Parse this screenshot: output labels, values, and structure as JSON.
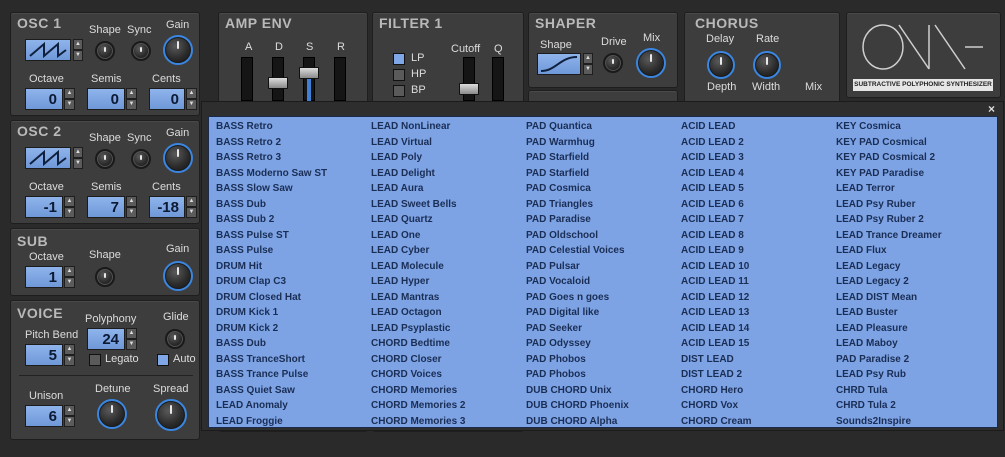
{
  "osc1": {
    "title": "OSC 1",
    "shape_label": "Shape",
    "sync_label": "Sync",
    "gain_label": "Gain",
    "octave_label": "Octave",
    "semis_label": "Semis",
    "cents_label": "Cents",
    "octave": "0",
    "semis": "0",
    "cents": "0"
  },
  "osc2": {
    "title": "OSC 2",
    "shape_label": "Shape",
    "sync_label": "Sync",
    "gain_label": "Gain",
    "octave_label": "Octave",
    "semis_label": "Semis",
    "cents_label": "Cents",
    "octave": "-1",
    "semis": "7",
    "cents": "-18"
  },
  "sub": {
    "title": "SUB",
    "octave_label": "Octave",
    "shape_label": "Shape",
    "gain_label": "Gain",
    "octave": "1"
  },
  "voice": {
    "title": "VOICE",
    "polyphony_label": "Polyphony",
    "glide_label": "Glide",
    "pitch_bend_label": "Pitch Bend",
    "polyphony": "24",
    "pitch_bend": "5",
    "legato_label": "Legato",
    "auto_label": "Auto",
    "legato_checked": false,
    "auto_checked": true
  },
  "unison": {
    "unison_label": "Unison",
    "detune_label": "Detune",
    "spread_label": "Spread",
    "unison": "6"
  },
  "amp_env": {
    "title": "AMP ENV",
    "a": "A",
    "d": "D",
    "s": "S",
    "r": "R"
  },
  "filter1": {
    "title": "FILTER 1",
    "cutoff_label": "Cutoff",
    "q_label": "Q",
    "modes": [
      "LP",
      "HP",
      "BP"
    ],
    "selected_mode": "LP"
  },
  "shaper": {
    "title": "SHAPER",
    "shape_label": "Shape",
    "drive_label": "Drive",
    "mix_label": "Mix"
  },
  "chorus": {
    "title": "CHORUS",
    "delay_label": "Delay",
    "rate_label": "Rate",
    "depth_label": "Depth",
    "width_label": "Width",
    "mix_label": "Mix"
  },
  "logo": {
    "subtitle": "SUBTRACTIVE POLYPHONIC SYNTHESIZER"
  },
  "preset_browser": {
    "close_symbol": "×",
    "columns": [
      [
        "BASS Retro",
        "BASS Retro 2",
        "BASS Retro 3",
        "BASS Moderno Saw ST",
        "BASS Slow Saw",
        "BASS Dub",
        "BASS Dub 2",
        "BASS Pulse ST",
        "BASS Pulse",
        "DRUM Hit",
        "DRUM Clap C3",
        "DRUM Closed Hat",
        "DRUM Kick 1",
        "DRUM Kick 2",
        "BASS Dub",
        "BASS TranceShort",
        "BASS Trance Pulse",
        "BASS Quiet Saw",
        "LEAD Anomaly",
        "LEAD Froggie"
      ],
      [
        "LEAD NonLinear",
        "LEAD Virtual",
        "LEAD Poly",
        "LEAD Delight",
        "LEAD Aura",
        "LEAD Sweet Bells",
        "LEAD Quartz",
        "LEAD One",
        "LEAD Cyber",
        "LEAD Molecule",
        "LEAD Hyper",
        "LEAD Mantras",
        "LEAD Octagon",
        "LEAD Psyplastic",
        "CHORD Bedtime",
        "CHORD Closer",
        "CHORD Voices",
        "CHORD Memories",
        "CHORD Memories 2",
        "CHORD Memories 3"
      ],
      [
        "PAD Quantica",
        "PAD Warmhug",
        "PAD Starfield",
        "PAD Starfield",
        "PAD Cosmica",
        "PAD Triangles",
        "PAD Paradise",
        "PAD Oldschool",
        "PAD Celestial Voices",
        "PAD Pulsar",
        "PAD Vocaloid",
        "PAD Goes n goes",
        "PAD Digital like",
        "PAD Seeker",
        "PAD Odyssey",
        "PAD Phobos",
        "PAD Phobos",
        "DUB CHORD Unix",
        "DUB CHORD Phoenix",
        "DUB CHORD Alpha"
      ],
      [
        "ACID LEAD",
        "ACID LEAD 2",
        "ACID LEAD 3",
        "ACID LEAD 4",
        "ACID LEAD 5",
        "ACID LEAD 6",
        "ACID LEAD 7",
        "ACID LEAD 8",
        "ACID LEAD 9",
        "ACID LEAD 10",
        "ACID LEAD 11",
        "ACID LEAD 12",
        "ACID LEAD 13",
        "ACID LEAD 14",
        "ACID LEAD 15",
        "DIST LEAD",
        "DIST LEAD 2",
        "CHORD Hero",
        "CHORD Vox",
        "CHORD Cream"
      ],
      [
        "KEY Cosmica",
        "KEY PAD Cosmical",
        "KEY PAD Cosmical 2",
        "KEY PAD Paradise",
        "LEAD Terror",
        "LEAD Psy Ruber",
        "LEAD Psy Ruber 2",
        "LEAD Trance Dreamer",
        "LEAD Flux",
        "LEAD Legacy",
        "LEAD Legacy 2",
        "LEAD DIST Mean",
        "LEAD Buster",
        "LEAD Pleasure",
        "LEAD Maboy",
        "PAD Paradise 2",
        "LEAD Psy Rub",
        "CHRD Tula",
        "CHRD Tula 2",
        "Sounds2Inspire"
      ]
    ]
  }
}
